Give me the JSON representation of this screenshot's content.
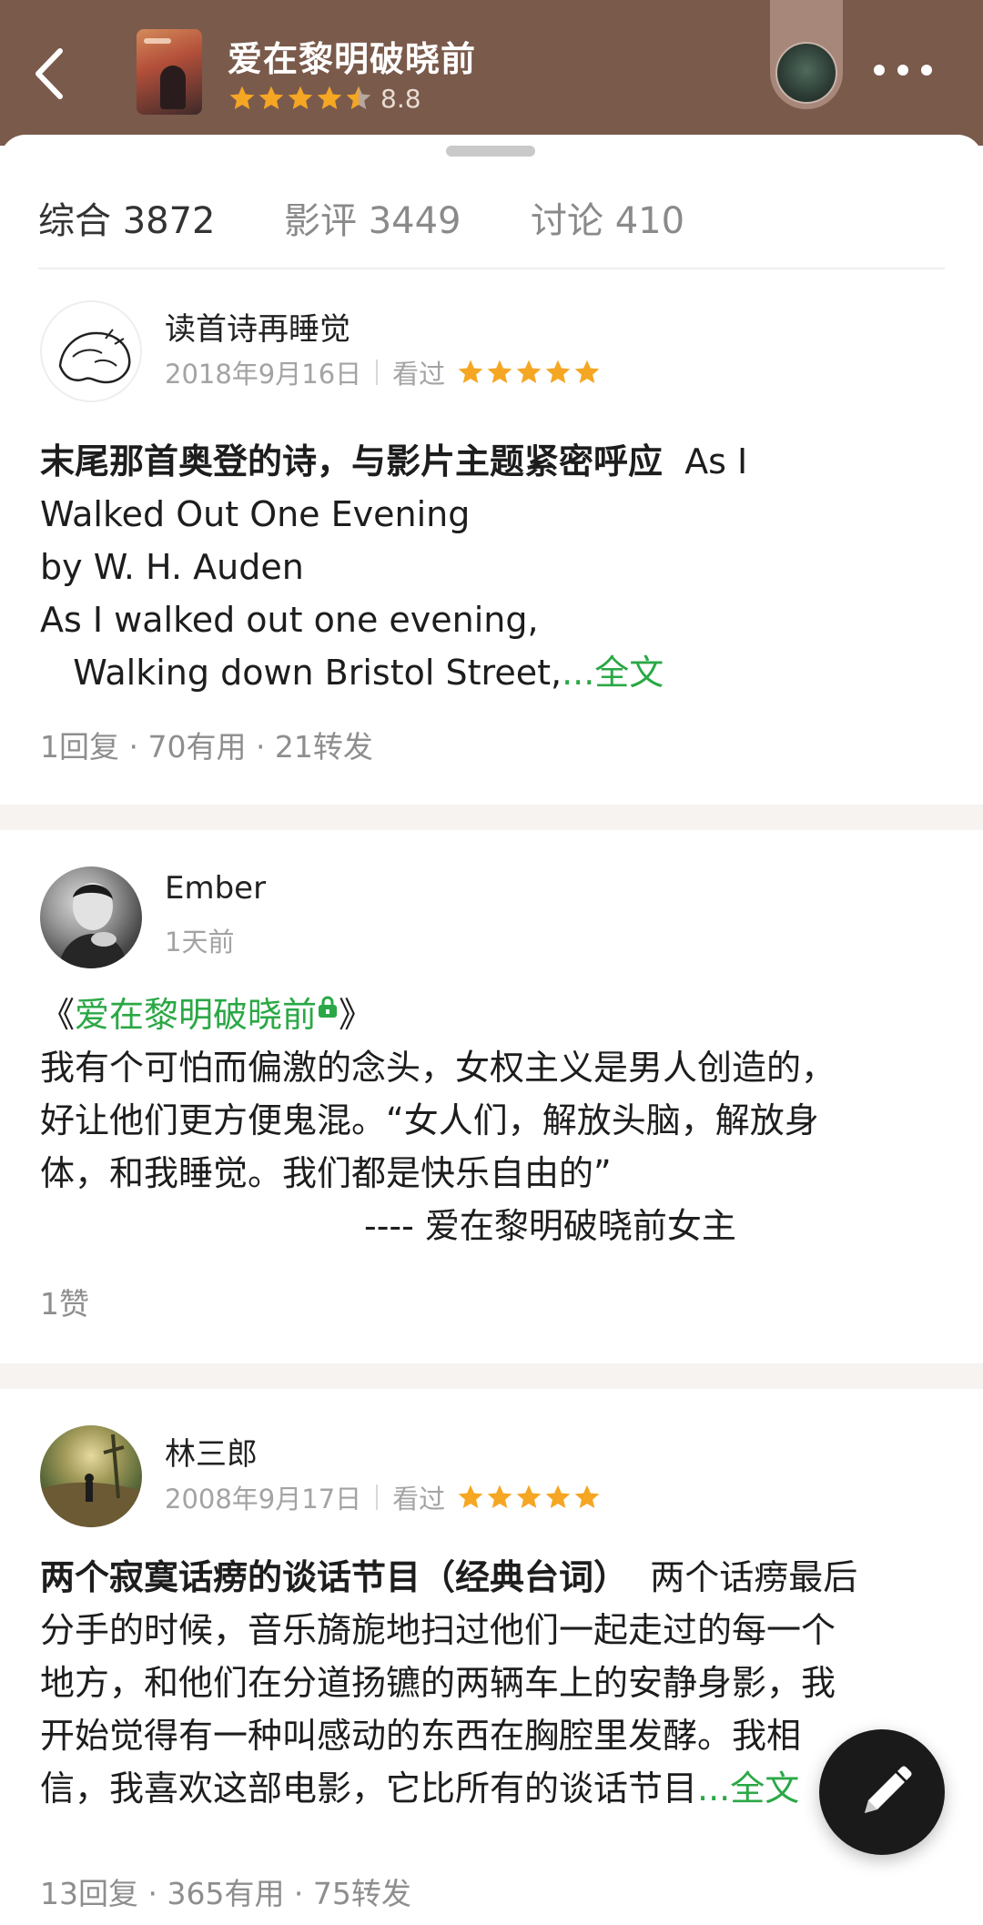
{
  "header": {
    "title": "爱在黎明破晓前",
    "rating": "8.8",
    "rating_stars": 4.5
  },
  "tabs": [
    {
      "label": "综合 3872"
    },
    {
      "label": "影评 3449"
    },
    {
      "label": "讨论 410"
    }
  ],
  "reviews": [
    {
      "user": "读首诗再睡觉",
      "date": "2018年9月16日",
      "status": "看过",
      "stars": 5,
      "title": "末尾那首奥登的诗，与影片主题紧密呼应",
      "lines": [
        "As I",
        "Walked Out One Evening",
        "by W. H. Auden",
        "As I walked out one evening,",
        "   Walking down Bristol Street,"
      ],
      "more": "...全文",
      "stats": "1回复 · 70有用 · 21转发"
    },
    {
      "user": "Ember",
      "date": "1天前",
      "bracket_open": "《",
      "bracket_close": "》",
      "movie_link": "爱在黎明破晓前",
      "lines": [
        "我有个可怕而偏激的念头，女权主义是男人创造的，",
        "好让他们更方便鬼混。“女人们，解放头脑，解放身",
        "体，和我睡觉。我们都是快乐自由的”",
        "---- 爱在黎明破晓前女主"
      ],
      "stats": "1赞"
    },
    {
      "user": "林三郎",
      "date": "2008年9月17日",
      "status": "看过",
      "stars": 5,
      "title": "两个寂寞话痨的谈话节目（经典台词）",
      "lines": [
        "两个话痨最后",
        "分手的时候，音乐旖旎地扫过他们一起走过的每一个",
        "地方，和他们在分道扬镳的两辆车上的安静身影，我",
        "开始觉得有一种叫感动的东西在胸腔里发酵。我相",
        "信，我喜欢这部电影，它比所有的谈话节目"
      ],
      "more": "...全文",
      "stats": "13回复 · 365有用 · 75转发"
    }
  ],
  "colors": {
    "header_bg": "#7a5a4b",
    "star": "#f5a623",
    "link_green": "#2aa845"
  },
  "icons": {
    "back": "chevron-left-icon",
    "more": "more-horizontal-icon",
    "write": "pencil-icon"
  }
}
